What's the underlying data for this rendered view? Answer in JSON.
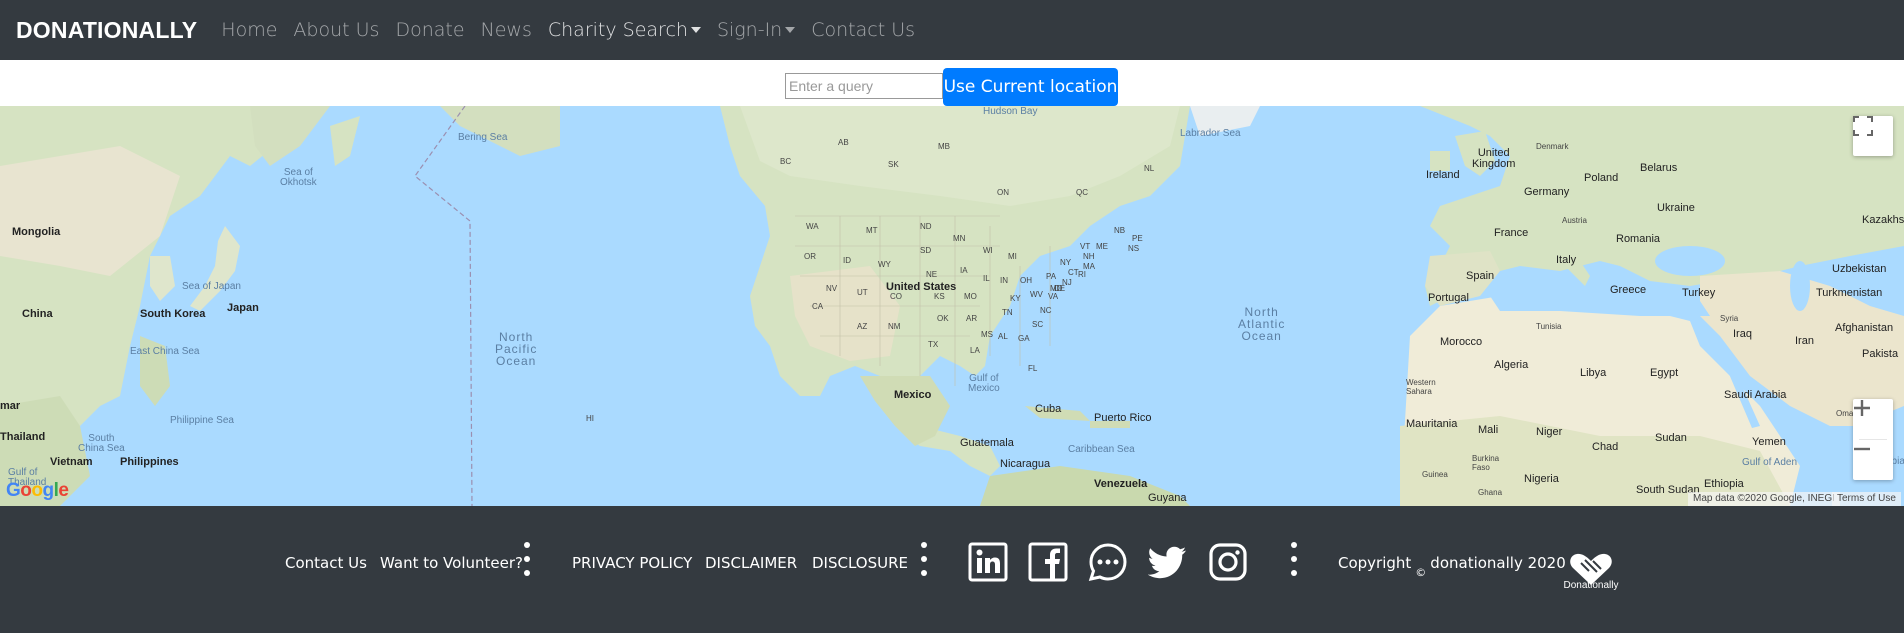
{
  "navbar": {
    "brand": "DONATIONALLY",
    "items": [
      {
        "label": "Home"
      },
      {
        "label": "About Us"
      },
      {
        "label": "Donate"
      },
      {
        "label": "News"
      },
      {
        "label": "Charity Search",
        "dropdown": true
      },
      {
        "label": "Sign-In",
        "dropdown": true
      },
      {
        "label": "Contact Us"
      }
    ]
  },
  "search": {
    "placeholder": "Enter a query",
    "button_label": "Use Current location",
    "button_color": "#007bff"
  },
  "map": {
    "provider_logo": "Google",
    "attribution": "Map data ©2020 Google, INEGI",
    "terms": "Terms of Use",
    "controls": [
      "fullscreen-icon",
      "zoom-in-icon",
      "zoom-out-icon"
    ],
    "labels": {
      "mongolia": "Mongolia",
      "china": "China",
      "south_korea": "South Korea",
      "japan": "Japan",
      "sea_of_okhotsk": "Sea of\nOkhotsk",
      "sea_of_japan": "Sea of Japan",
      "east_china_sea": "East China Sea",
      "philippine_sea": "Philippine Sea",
      "south_china_sea": "South\nChina Sea",
      "philippines": "Philippines",
      "vietnam": "Vietnam",
      "thailand": "Thailand",
      "myanmar": "mar",
      "gulf_of_thailand": "Gulf of\nThailand",
      "bering_sea": "Bering Sea",
      "north_pacific_ocean": "North\nPacific\nOcean",
      "hi": "HI",
      "hudson_bay": "Hudson Bay",
      "labrador_sea": "Labrador Sea",
      "united_states": "United States",
      "mexico": "Mexico",
      "gulf_of_mexico": "Gulf of\nMexico",
      "cuba": "Cuba",
      "puerto_rico": "Puerto Rico",
      "guatemala": "Guatemala",
      "nicaragua": "Nicaragua",
      "caribbean_sea": "Caribbean Sea",
      "venezuela": "Venezuela",
      "guyana": "Guyana",
      "north_atlantic_ocean": "North\nAtlantic\nOcean",
      "united_kingdom": "United\nKingdom",
      "ireland": "Ireland",
      "denmark": "Denmark",
      "germany": "Germany",
      "poland": "Poland",
      "belarus": "Belarus",
      "ukraine": "Ukraine",
      "france": "France",
      "austria": "Austria",
      "romania": "Romania",
      "kazakhstan": "Kazakhsta",
      "spain": "Spain",
      "italy": "Italy",
      "portugal": "Portugal",
      "greece": "Greece",
      "turkey": "Turkey",
      "uzbekistan": "Uzbekistan",
      "turkmenistan": "Turkmenistan",
      "tunisia": "Tunisia",
      "morocco": "Morocco",
      "syria": "Syria",
      "iraq": "Iraq",
      "iran": "Iran",
      "afghanistan": "Afghanistan",
      "pakistan": "Pakista",
      "algeria": "Algeria",
      "libya": "Libya",
      "egypt": "Egypt",
      "western_sahara": "Western\nSahara",
      "saudi_arabia": "Saudi Arabia",
      "oman": "Oman",
      "mauritania": "Mauritania",
      "mali": "Mali",
      "niger": "Niger",
      "chad": "Chad",
      "sudan": "Sudan",
      "yemen": "Yemen",
      "gulf_of_aden": "Gulf of Aden",
      "burkina_faso": "Burkina\nFaso",
      "guinea": "Guinea",
      "nigeria": "Nigeria",
      "ghana": "Ghana",
      "ethiopia": "Ethiopia",
      "south_sudan": "South Sudan",
      "arabian_sea": "Arabia",
      "states": [
        "AB",
        "SK",
        "MB",
        "BC",
        "ON",
        "QC",
        "NL",
        "WA",
        "MT",
        "ND",
        "OR",
        "ID",
        "SD",
        "WY",
        "NE",
        "NV",
        "UT",
        "CO",
        "KS",
        "CA",
        "AZ",
        "NM",
        "OK",
        "TX",
        "MN",
        "WI",
        "MI",
        "IA",
        "IL",
        "IN",
        "OH",
        "MO",
        "KY",
        "TN",
        "AR",
        "MS",
        "AL",
        "GA",
        "LA",
        "FL",
        "SC",
        "NC",
        "VA",
        "WV",
        "PA",
        "NY",
        "VT",
        "ME",
        "NH",
        "MA",
        "NB",
        "NS",
        "PE",
        "CT",
        "RI",
        "NJ",
        "DE",
        "MD"
      ]
    }
  },
  "footer": {
    "contact": "Contact Us",
    "volunteer": "Want to Volunteer?",
    "privacy": "PRIVACY POLICY",
    "disclaimer": "DISCLAIMER",
    "disclosure": "DISCLOSURE",
    "social": [
      "linkedin-icon",
      "facebook-icon",
      "chat-icon",
      "twitter-icon",
      "instagram-icon"
    ],
    "copyright_label": "Copyright",
    "copyright_symbol": "©",
    "copyright_owner": "donationally 2020",
    "logo_text": "Donationally"
  }
}
